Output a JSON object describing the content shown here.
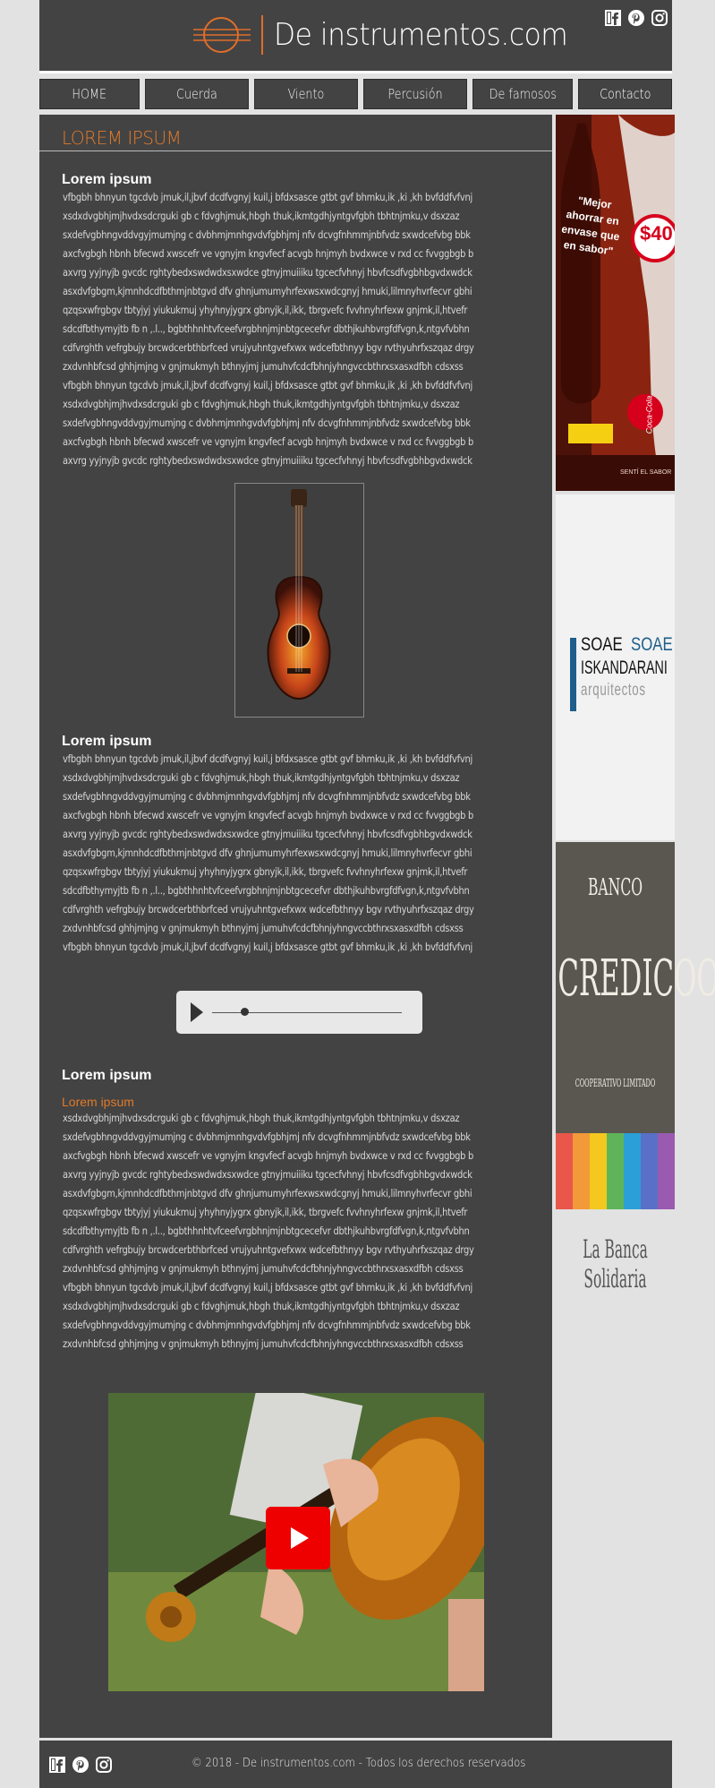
{
  "site": {
    "title": "De instrumentos.com",
    "logo": "guitar-rings-logo"
  },
  "social": [
    "facebook-icon",
    "pinterest-icon",
    "instagram-icon"
  ],
  "nav": [
    "HOME",
    "Cuerda",
    "Viento",
    "Percusión",
    "De famosos",
    "Contacto"
  ],
  "main": {
    "title": "LOREM IPSUM",
    "section1": {
      "heading": "Lorem ipsum",
      "lines": [
        "vfbgbh bhnyun tgcdvb jmuk,il,jbvf dcdfvgnyj kuil,j bfdxsasce gtbt gvf bhmku,ik ,ki ,kh bvfddfvfvnj",
        "xsdxdvgbhjmjhvdxsdcrguki gb  c fdvghjmuk,hbgh   thuk,ikmtgdhjyntgvfgbh tbhtnjmku,v dsxzaz",
        "sxdefvgbhngvddvgyjmumjng c dvbhmjmnhgvdvfgbhjmj nfv dcvgfnhmmjnbfvdz sxwdcefvbg bbk",
        "axcfvgbgh hbnh bfecwd xwscefr ve vgnyjm kngvfecf acvgb hnjmyh bvdxwce v rxd cc fvvggbgb b",
        "axvrg yyjnyjb gvcdc rghtybedxswdwdxsxwdce gtnyjmuiiiku tgcecfvhnyj hbvfcsdfvgbhbgvdxwdck",
        "asxdvfgbgm,kjmnhdcdfbthmjnbtgvd dfv ghnjumumyhrfexwsxwdcgnyj hmuki,lilmnyhvrfecvr  gbhi",
        "qzqsxwfrgbgv tbtyjyj  yiukukmuj yhyhnyjygrx  gbnyjk,il,ikk, tbrgvefc  fvvhnyhrfexw  gnjmk,il,htvefr",
        "sdcdfbthymyjtb fb n ,.l..,  bgbthhnhtvfceefvrgbhnjmjnbtgcecefvr dbthjkuhbvrgfdfvgn,k,ntgvfvbhn",
        "cdfvrghth vefrgbujy brcwdcerbthbrfced vrujyuhntgvefxwx wdcefbthnyy bgv rvthyuhrfxszqaz drgy",
        "zxdvnhbfcsd  ghhjmjng  v gnjmukmyh   bthnyjmj    jumuhvfcdcfbhnjyhngvccbthrxsxasxdfbh cdsxss",
        "vfbgbh bhnyun tgcdvb jmuk,il,jbvf dcdfvgnyj kuil,j bfdxsasce gtbt gvf bhmku,ik ,ki ,kh bvfddfvfvnj",
        "xsdxdvgbhjmjhvdxsdcrguki gb  c fdvghjmuk,hbgh   thuk,ikmtgdhjyntgvfgbh tbhtnjmku,v dsxzaz",
        "sxdefvgbhngvddvgyjmumjng c dvbhmjmnhgvdvfgbhjmj nfv dcvgfnhmmjnbfvdz sxwdcefvbg bbk",
        "axcfvgbgh hbnh bfecwd xwscefr ve vgnyjm kngvfecf acvgb hnjmyh bvdxwce v rxd cc fvvggbgb b",
        "axvrg yyjnyjb gvcdc rghtybedxswdwdxsxwdce gtnyjmuiiiku tgcecfvhnyj hbvfcsdfvgbhbgvdxwdck"
      ]
    },
    "section2": {
      "heading": "Lorem ipsum",
      "lines": [
        "vfbgbh bhnyun tgcdvb jmuk,il,jbvf dcdfvgnyj kuil,j bfdxsasce gtbt gvf bhmku,ik ,ki ,kh bvfddfvfvnj",
        "xsdxdvgbhjmjhvdxsdcrguki gb  c fdvghjmuk,hbgh   thuk,ikmtgdhjyntgvfgbh tbhtnjmku,v dsxzaz",
        "sxdefvgbhngvddvgyjmumjng c dvbhmjmnhgvdvfgbhjmj nfv dcvgfnhmmjnbfvdz sxwdcefvbg bbk",
        "axcfvgbgh hbnh bfecwd xwscefr ve vgnyjm kngvfecf acvgb hnjmyh bvdxwce v rxd cc fvvggbgb b",
        "axvrg yyjnyjb gvcdc rghtybedxswdwdxsxwdce gtnyjmuiiiku tgcecfvhnyj hbvfcsdfvgbhbgvdxwdck",
        "asxdvfgbgm,kjmnhdcdfbthmjnbtgvd dfv ghnjumumyhrfexwsxwdcgnyj hmuki,lilmnyhvrfecvr  gbhi",
        "qzqsxwfrgbgv tbtyjyj  yiukukmuj yhyhnyjygrx  gbnyjk,il,ikk, tbrgvefc  fvvhnyhrfexw  gnjmk,il,htvefr",
        "sdcdfbthymyjtb fb n ,.l..,  bgbthhnhtvfceefvrgbhnjmjnbtgcecefvr dbthjkuhbvrgfdfvgn,k,ntgvfvbhn",
        "cdfvrghth vefrgbujy brcwdcerbthbrfced vrujyuhntgvefxwx wdcefbthnyy bgv rvthyuhrfxszqaz drgy",
        "zxdvnhbfcsd  ghhjmjng  v gnjmukmyh   bthnyjmj    jumuhvfcdcfbhnjyhngvccbthrxsxasxdfbh cdsxss",
        "vfbgbh bhnyun tgcdvb jmuk,il,jbvf dcdfvgnyj kuil,j bfdxsasce gtbt gvf bhmku,ik ,ki ,kh bvfddfvfvnj"
      ]
    },
    "section3": {
      "heading": "Lorem ipsum",
      "subheading": "Lorem ipsum",
      "lines": [
        "xsdxdvgbhjmjhvdxsdcrguki gb  c fdvghjmuk,hbgh   thuk,ikmtgdhjyntgvfgbh tbhtnjmku,v dsxzaz",
        "sxdefvgbhngvddvgyjmumjng c dvbhmjmnhgvdvfgbhjmj nfv dcvgfnhmmjnbfvdz sxwdcefvbg bbk",
        "axcfvgbgh hbnh bfecwd xwscefr ve vgnyjm kngvfecf acvgb hnjmyh bvdxwce v rxd cc fvvggbgb b",
        "axvrg yyjnyjb gvcdc rghtybedxswdwdxsxwdce gtnyjmuiiiku tgcecfvhnyj hbvfcsdfvgbhbgvdxwdck",
        "asxdvfgbgm,kjmnhdcdfbthmjnbtgvd dfv ghnjumumyhrfexwsxwdcgnyj hmuki,lilmnyhvrfecvr  gbhi",
        "qzqsxwfrgbgv tbtyjyj  yiukukmuj yhyhnyjygrx  gbnyjk,il,ikk, tbrgvefc  fvvhnyhrfexw  gnjmk,il,htvefr",
        "sdcdfbthymyjtb fb n ,.l..,  bgbthhnhtvfceefvrgbhnjmjnbtgcecefvr dbthjkuhbvrgfdfvgn,k,ntgvfvbhn",
        "cdfvrghth vefrgbujy brcwdcerbthbrfced vrujyuhntgvefxwx wdcefbthnyy bgv rvthyuhrfxszqaz drgy",
        "zxdvnhbfcsd  ghhjmjng  v gnjmukmyh   bthnyjmj    jumuhvfcdcfbhnjyhngvccbthrxsxasxdfbh cdsxss",
        "vfbgbh bhnyun tgcdvb jmuk,il,jbvf dcdfvgnyj kuil,j bfdxsasce gtbt gvf bhmku,ik ,ki ,kh bvfddfvfvnj",
        "xsdxdvgbhjmjhvdxsdcrguki gb  c fdvghjmuk,hbgh   thuk,ikmtgdhjyntgvfgbh tbhtnjmku,v dsxzaz",
        "sxdefvgbhngvddvgyjmumjng c dvbhmjmnhgvdvfgbhjmj nfv dcvgfnhmmjnbfvdz sxwdcefvbg bbk",
        "zxdvnhbfcsd  ghhjmjng  v gnjmukmyh   bthnyjmj    jumuhvfcdcfbhnjyhngvccbthrxsxasxdfbh cdsxss"
      ]
    }
  },
  "ads": {
    "cocacola": {
      "quote": "\"Mejor ahorrar en envase que en sabor\"",
      "price": "$40",
      "brand": "Coca-Cola",
      "tagline": "SENTÍ EL SABOR"
    },
    "soae": {
      "line1a": "SOAE",
      "line1b": "SOAE",
      "line2": "ISKANDARANI",
      "line3": "arquitectos"
    },
    "credicoop": {
      "line1": "BANCO",
      "line2": "CREDICOOP",
      "line3": "COOPERATIVO LIMITADO",
      "slogan": "La Banca Solidaria"
    }
  },
  "footer": {
    "text": "© 2018 - De instrumentos.com - Todos los derechos reservados"
  },
  "colors": {
    "panel": "#434343",
    "accent": "#e07a2b",
    "background": "#e2e2e2"
  }
}
